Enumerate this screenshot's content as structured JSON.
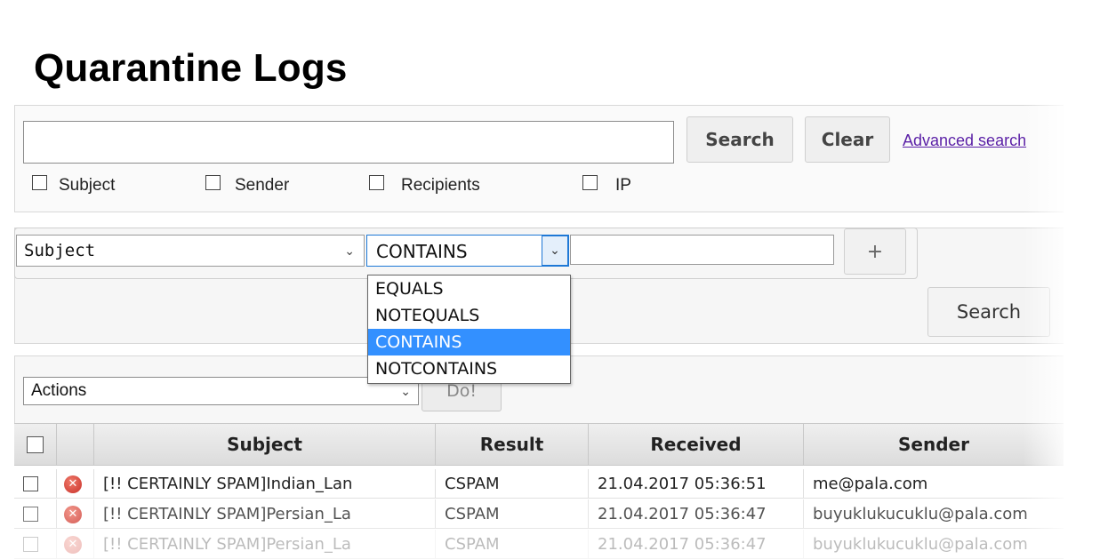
{
  "page": {
    "title": "Quarantine Logs"
  },
  "quick_search": {
    "query": "",
    "search_label": "Search",
    "clear_label": "Clear",
    "advanced_link": "Advanced search",
    "checkboxes": [
      {
        "label": "Subject",
        "checked": false
      },
      {
        "label": "Sender",
        "checked": false
      },
      {
        "label": "Recipients",
        "checked": false
      },
      {
        "label": "IP",
        "checked": false
      }
    ]
  },
  "advanced_filter": {
    "field": "Subject",
    "operator": "CONTAINS",
    "value": "",
    "add_label": "+",
    "search_label": "Search",
    "operator_options": [
      "EQUALS",
      "NOTEQUALS",
      "CONTAINS",
      "NOTCONTAINS"
    ],
    "selected_option": "CONTAINS"
  },
  "actions": {
    "selected": "Actions",
    "do_label": "Do!"
  },
  "table": {
    "columns": [
      "Subject",
      "Result",
      "Received",
      "Sender"
    ],
    "rows": [
      {
        "subject": "[!! CERTAINLY SPAM]Indian_Lan",
        "result": "CSPAM",
        "received": "21.04.2017 05:36:51",
        "sender": "me@pala.com"
      },
      {
        "subject": "[!! CERTAINLY SPAM]Persian_La",
        "result": "CSPAM",
        "received": "21.04.2017 05:36:47",
        "sender": "buyuklukucuklu@pala.com"
      },
      {
        "subject": "[!! CERTAINLY SPAM]Persian_La",
        "result": "CSPAM",
        "received": "21.04.2017 05:36:47",
        "sender": "buyuklukucuklu@pala.com"
      }
    ]
  },
  "icons": {
    "checkbox": "checkbox-icon",
    "chevron": "chevron-down-icon",
    "spam_status": "spam-x-icon"
  },
  "colors": {
    "dropdown_highlight": "#3390ff",
    "select_focus_border": "#1e78d6",
    "link": "#5a1fa6",
    "spam_icon": "#d9403a"
  }
}
